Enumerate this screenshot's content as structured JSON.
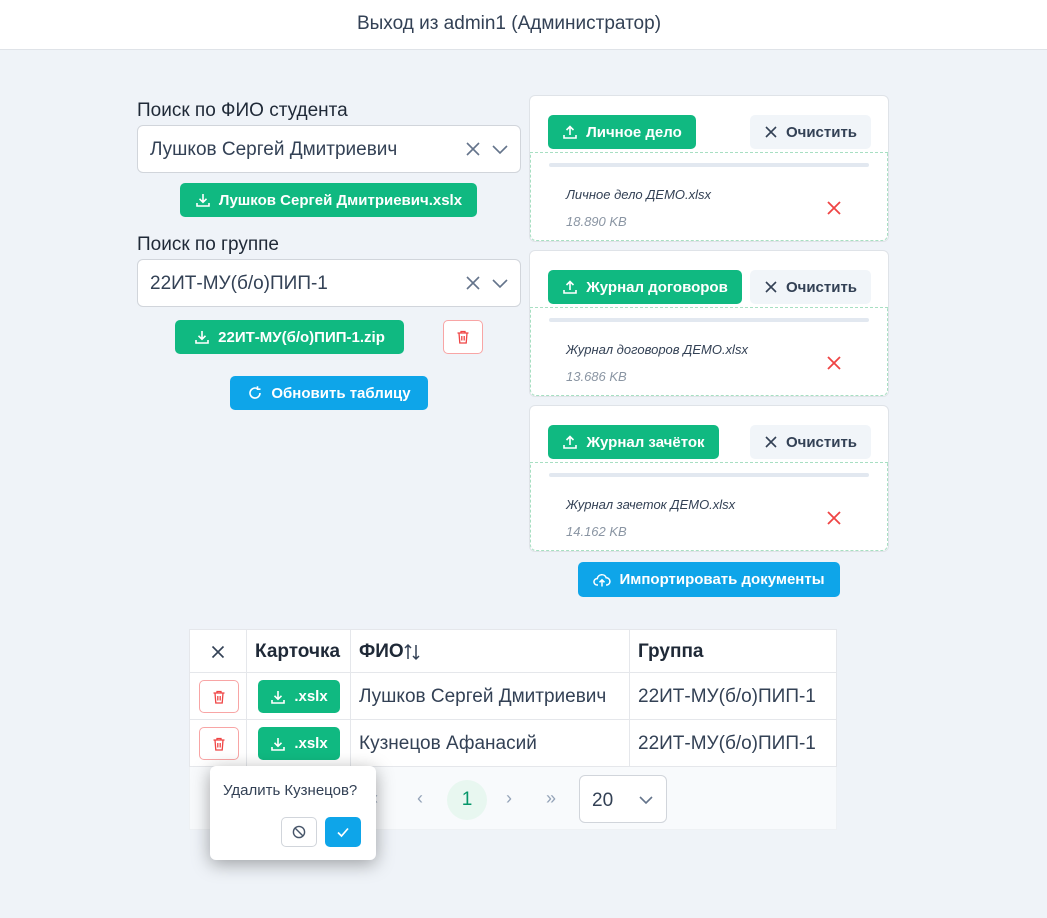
{
  "header": {
    "logout_text": "Выход из admin1 (Администратор)"
  },
  "search_student": {
    "label": "Поиск по ФИО студента",
    "value": "Лушков Сергей Дмитриевич",
    "download_label": "Лушков Сергей Дмитриевич.xslx"
  },
  "search_group": {
    "label": "Поиск по группе",
    "value": "22ИТ-МУ(б/о)ПИП-1",
    "download_label": "22ИТ-МУ(б/о)ПИП-1.zip"
  },
  "refresh_label": "Обновить таблицу",
  "uploads": [
    {
      "button": "Личное дело",
      "clear": "Очистить",
      "file_name": "Личное дело ДЕМО.xlsx",
      "file_size": "18.890 KB"
    },
    {
      "button": "Журнал договоров",
      "clear": "Очистить",
      "file_name": "Журнал договоров ДЕМО.xlsx",
      "file_size": "13.686 KB"
    },
    {
      "button": "Журнал зачёток",
      "clear": "Очистить",
      "file_name": "Журнал зачеток ДЕМО.xlsx",
      "file_size": "14.162 KB"
    }
  ],
  "import_label": "Импортировать документы",
  "table": {
    "headers": {
      "card": "Карточка",
      "fio": "ФИО",
      "group": "Группа"
    },
    "download_label": ".xslx",
    "rows": [
      {
        "fio": "Лушков Сергей Дмитриевич",
        "group": "22ИТ-МУ(б/о)ПИП-1"
      },
      {
        "fio": "Кузнецов Афанасий",
        "group": "22ИТ-МУ(б/о)ПИП-1"
      }
    ]
  },
  "pagination": {
    "current_page": "1",
    "rows_per_page": "20"
  },
  "confirm_popup": {
    "message": "Удалить Кузнецов?"
  },
  "colors": {
    "green": "#10b981",
    "blue": "#0ea5e9",
    "red": "#ef4444"
  },
  "icons": [
    "upload-icon",
    "download-icon",
    "close-icon",
    "chevron-down-icon",
    "trash-icon",
    "refresh-icon",
    "cloud-upload-icon",
    "sort-icon",
    "check-icon",
    "ban-icon"
  ]
}
